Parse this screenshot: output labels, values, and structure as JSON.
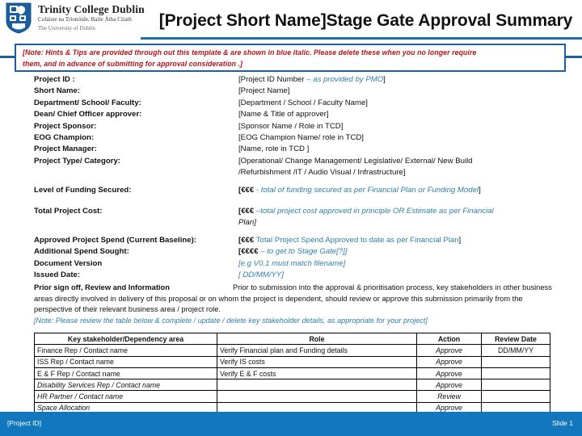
{
  "header": {
    "org_name": "Trinity College Dublin",
    "org_sub_irish": "Coláiste na Tríonóide, Baile Átha Cliath",
    "org_sub_en": "The University of Dublin",
    "slide_title": "[Project Short Name]Stage Gate Approval Summary",
    "accent_color": "#1f6eb0",
    "crest_icon": "tcd-shield-icon"
  },
  "note": {
    "line1": "[Note: Hints & Tips are provided through out this template & are shown in blue italic. Please delete these when you no longer require",
    "line2": "them, and in advance of submitting for approval consideration .]",
    "border_color": "#1f5fa0",
    "text_color": "#b5121b"
  },
  "fields": [
    {
      "label": "Project ID :",
      "value": "[Project ID Number ",
      "hint": "– as provided by PMO",
      "tail": "]"
    },
    {
      "label": "Short Name:",
      "value": "[Project Name]"
    },
    {
      "label": "Department/ School/ Faculty:",
      "value": "[Department / School / Faculty Name]"
    },
    {
      "label": "Dean/ Chief Officer approver:",
      "value": "[Name & Title of approver]"
    },
    {
      "label": "Project Sponsor:",
      "value": "[Sponsor Name / Role in TCD]"
    },
    {
      "label": "EOG Champion:",
      "value": "[EOG Champion Name/ role in TCD]"
    },
    {
      "label": "Project Manager:",
      "value": "[Name, role in TCD ]"
    },
    {
      "label": "Project Type/ Category:",
      "value": "[Operational/ Change Management/ Legislative/ External/ New Build",
      "continuation": "/Refurbishment /IT / Audio Visual / Infrastructure]"
    }
  ],
  "funding": {
    "label": "Level of Funding Secured:",
    "prefix": "[€€€",
    "hint": " - total of funding secured as per Financial Plan or Funding Model",
    "tail": "]"
  },
  "cost": {
    "label": "Total Project Cost:",
    "prefix": "[€€€ ",
    "hint": "–total project cost approved in principle OR Estimate as per Financial",
    "hint_cont": "Plan]"
  },
  "spend": {
    "label": "Approved Project Spend (Current Baseline):",
    "prefix": "[€€€ ",
    "hint": "Total Project Spend Approved to date as per Financial Plan",
    "tail": "]"
  },
  "additional": {
    "label": "Additional Spend Sought:",
    "prefix": "[€€€€ ",
    "hint": "– to get to Stage  Gate[?]]"
  },
  "version": {
    "label": "Document Version",
    "hint": "[e.g V0.1 must match filename]"
  },
  "issued": {
    "label": "Issued Date:",
    "hint": "[ DD/MM/YY]"
  },
  "paragraph": {
    "title": "Prior sign off, Review and Information",
    "body": "Prior to submission into the approval & prioritisation process, key stakeholders in other business areas directly involved in delivery of this proposal or on whom the project is dependent, should review or approve this submission primarily from the perspective of their relevant business area / project role.",
    "note": "[Note: Please review the table below & complete / update / delete key stakeholder details, as appropriate for your project]"
  },
  "table": {
    "headers": [
      "Key stakeholder/Dependency area",
      "Role",
      "Action",
      "Review Date"
    ],
    "rows": [
      {
        "stakeholder": "Finance Rep / Contact name",
        "role": "Verify Financial plan and Funding details",
        "action": "Approve",
        "review_date": "DD/MM/YY",
        "style": "plain"
      },
      {
        "stakeholder": "ISS Rep / Contact  name",
        "role": "Verify IS costs",
        "action": "Approve",
        "review_date": "",
        "style": "plain"
      },
      {
        "stakeholder": "E & F Rep / Contact name",
        "role": "Verify  E & F costs",
        "action": "Approve",
        "review_date": "",
        "style": "plain"
      },
      {
        "stakeholder": "Disability Services Rep / Contact name",
        "role": "",
        "action": "Approve",
        "review_date": "",
        "style": "blue"
      },
      {
        "stakeholder": "HR Partner / Contact name",
        "role": "",
        "action": "Review",
        "review_date": "",
        "style": "blue"
      },
      {
        "stakeholder": "Space Allocation",
        "role": "",
        "action": "Approve",
        "review_date": "",
        "style": "blue"
      }
    ]
  },
  "footer": {
    "left": "[Project ID]",
    "right": "Slide 1",
    "bg_color": "#1277bc"
  }
}
